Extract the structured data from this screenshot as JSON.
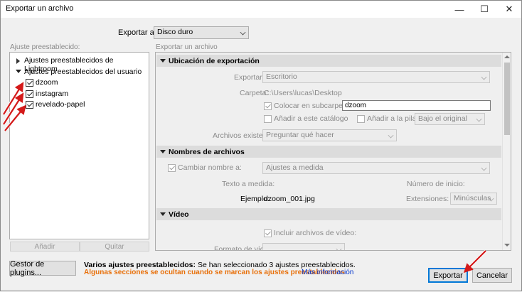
{
  "window": {
    "title": "Exportar un archivo",
    "minimize": "—",
    "maximize": "☐",
    "close": "✕"
  },
  "export_to": {
    "label": "Exportar a:",
    "value": "Disco duro"
  },
  "presets": {
    "label": "Ajuste preestablecido:",
    "groups": [
      {
        "label": "Ajustes preestablecidos de Lightroom",
        "expanded": false
      },
      {
        "label": "Ajustes preestablecidos del usuario",
        "expanded": true
      }
    ],
    "items": [
      {
        "label": "dzoom",
        "checked": true
      },
      {
        "label": "instagram",
        "checked": true
      },
      {
        "label": "revelado-papel",
        "checked": true
      }
    ],
    "add_button": "Añadir",
    "remove_button": "Quitar"
  },
  "settings": {
    "label": "Exportar un archivo",
    "location": {
      "header": "Ubicación de exportación",
      "export_to_label": "Exportar a:",
      "export_to_value": "Escritorio",
      "folder_label": "Carpeta:",
      "folder_value": "C:\\Users\\lucas\\Desktop",
      "subfolder_label": "Colocar en subcarpeta:",
      "subfolder_value": "dzoom",
      "add_catalog_label": "Añadir a este catálogo",
      "add_stack_label": "Añadir a la pila:",
      "stack_value": "Bajo el original",
      "existing_files_label": "Archivos existentes:",
      "existing_files_value": "Preguntar qué hacer"
    },
    "file_naming": {
      "header": "Nombres de archivos",
      "rename_label": "Cambiar nombre a:",
      "rename_value": "Ajustes a medida",
      "custom_text_label": "Texto a medida:",
      "start_number_label": "Número de inicio:",
      "example_label": "Ejemplo:",
      "example_value": "dzoom_001.jpg",
      "extensions_label": "Extensiones:",
      "extensions_value": "Minúsculas"
    },
    "video": {
      "header": "Vídeo",
      "include_label": "Incluir archivos de vídeo:",
      "format_label": "Formato de vídeo:"
    }
  },
  "footer": {
    "plugin_manager": "Gestor de plugins...",
    "status_title": "Varios ajustes preestablecidos:",
    "status_text": "Se han seleccionado 3 ajustes preestablecidos.",
    "warning": "Algunas secciones se ocultan cuando se marcan los ajustes preestablecidos",
    "more_info": "Más información",
    "export_button": "Exportar",
    "cancel_button": "Cancelar"
  },
  "colors": {
    "warning": "#e8700a",
    "link": "#0033cc",
    "annotation_arrow": "#d41a1a",
    "accent": "#0078d7"
  }
}
